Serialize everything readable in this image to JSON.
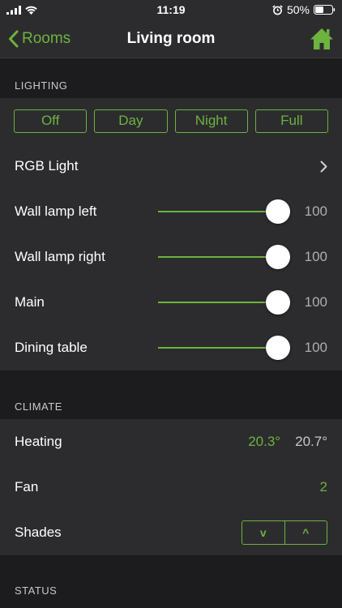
{
  "status_bar": {
    "time": "11:19",
    "battery_text": "50%",
    "battery_level": 0.5
  },
  "nav": {
    "back_label": "Rooms",
    "title": "Living room"
  },
  "lighting": {
    "header": "LIGHTING",
    "scenes": [
      "Off",
      "Day",
      "Night",
      "Full"
    ],
    "rgb_label": "RGB Light",
    "dimmers": [
      {
        "label": "Wall lamp left",
        "value": 100
      },
      {
        "label": "Wall lamp right",
        "value": 100
      },
      {
        "label": "Main",
        "value": 100
      },
      {
        "label": "Dining table",
        "value": 100
      }
    ]
  },
  "climate": {
    "header": "CLIMATE",
    "heating_label": "Heating",
    "heating_current": "20.3°",
    "heating_target": "20.7°",
    "fan_label": "Fan",
    "fan_value": "2",
    "shades_label": "Shades",
    "shades_down": "v",
    "shades_up": "^"
  },
  "status_section": {
    "header": "STATUS"
  },
  "colors": {
    "accent": "#6cb33f",
    "background": "#1c1c1e",
    "cell": "#2c2c2e"
  }
}
